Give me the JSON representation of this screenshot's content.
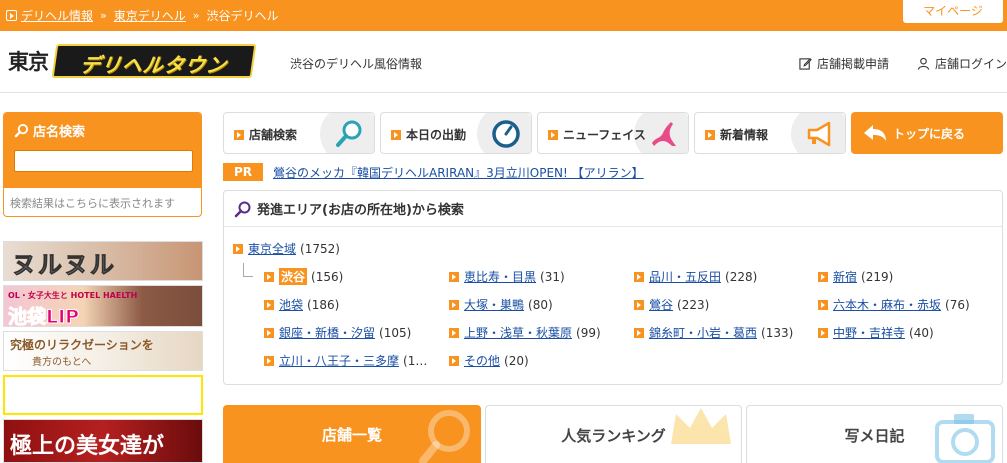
{
  "breadcrumb": {
    "items": [
      "デリヘル情報",
      "東京デリヘル",
      "渋谷デリヘル"
    ],
    "separator": "»"
  },
  "header": {
    "mypage_label": "マイページ",
    "logo_prefix": "東京",
    "logo_main": "デリヘルタウン",
    "tagline": "渋谷のデリヘル風俗情報",
    "listing_label": "店舗掲載申請",
    "login_label": "店舗ログイン"
  },
  "sidebar": {
    "search_title": "店名検索",
    "search_placeholder": "",
    "search_note": "検索結果はこちらに表示されます",
    "banners": [
      {
        "text": "ヌルヌル"
      },
      {
        "text_small": "OL・女子大生と HOTEL HAELTH",
        "text_main": "池袋LIP"
      },
      {
        "text_main": "究極のリラクゼーションを",
        "text_sub": "貴方のもとへ"
      },
      {
        "text": ""
      },
      {
        "text": "極上の美女達が"
      }
    ]
  },
  "nav": {
    "buttons": [
      {
        "label": "店舗検索",
        "icon": "magnifier-icon"
      },
      {
        "label": "本日の出勤",
        "icon": "clock-icon"
      },
      {
        "label": "ニューフェイス",
        "icon": "woman-silhouette-icon"
      },
      {
        "label": "新着情報",
        "icon": "megaphone-icon"
      }
    ],
    "top_label": "トップに戻る"
  },
  "pr": {
    "tag": "PR",
    "text": "鶯谷のメッカ『韓国デリヘルARIRAN』3月立川OPEN! 【アリラン】"
  },
  "area": {
    "title": "発進エリア(お店の所在地)から検索",
    "root": {
      "name": "東京全域",
      "count": "(1752)"
    },
    "items": [
      {
        "name": "渋谷",
        "count": "(156)",
        "current": true
      },
      {
        "name": "恵比寿・目黒",
        "count": "(31)"
      },
      {
        "name": "品川・五反田",
        "count": "(228)"
      },
      {
        "name": "新宿",
        "count": "(219)"
      },
      {
        "name": "池袋",
        "count": "(186)"
      },
      {
        "name": "大塚・巣鴨",
        "count": "(80)"
      },
      {
        "name": "鶯谷",
        "count": "(223)"
      },
      {
        "name": "六本木・麻布・赤坂",
        "count": "(76)"
      },
      {
        "name": "銀座・新橋・汐留",
        "count": "(105)"
      },
      {
        "name": "上野・浅草・秋葉原",
        "count": "(99)"
      },
      {
        "name": "錦糸町・小岩・葛西",
        "count": "(133)"
      },
      {
        "name": "中野・吉祥寺",
        "count": "(40)"
      },
      {
        "name": "立川・八王子・三多摩",
        "count": "(1…"
      },
      {
        "name": "その他",
        "count": "(20)"
      }
    ]
  },
  "tabs": [
    "店舗一覧",
    "人気ランキング",
    "写メ日記"
  ],
  "colors": {
    "accent": "#f7931e",
    "link": "#1a4fa3"
  }
}
